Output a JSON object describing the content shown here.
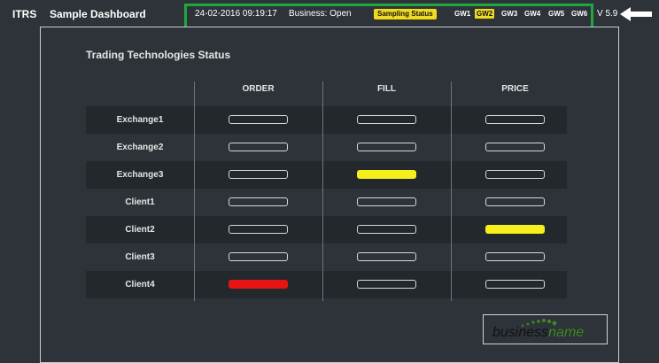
{
  "header": {
    "brand": "ITRS",
    "title": "Sample Dashboard",
    "datetime": "24-02-2016 09:19:17",
    "business_status": "Business: Open",
    "sampling_status": "Sampling Status",
    "gateways": [
      {
        "label": "GW1",
        "active": false
      },
      {
        "label": "GW2",
        "active": true
      },
      {
        "label": "GW3",
        "active": false
      },
      {
        "label": "GW4",
        "active": false
      },
      {
        "label": "GW5",
        "active": false
      },
      {
        "label": "GW6",
        "active": false
      }
    ],
    "version": "V 5.9"
  },
  "panel": {
    "title": "Trading Technologies Status",
    "columns": [
      "ORDER",
      "FILL",
      "PRICE"
    ],
    "rows": [
      {
        "label": "Exchange1",
        "states": [
          "ok",
          "ok",
          "ok"
        ]
      },
      {
        "label": "Exchange2",
        "states": [
          "ok",
          "ok",
          "ok"
        ]
      },
      {
        "label": "Exchange3",
        "states": [
          "ok",
          "warning",
          "ok"
        ]
      },
      {
        "label": "Client1",
        "states": [
          "ok",
          "ok",
          "ok"
        ]
      },
      {
        "label": "Client2",
        "states": [
          "ok",
          "ok",
          "warning"
        ]
      },
      {
        "label": "Client3",
        "states": [
          "ok",
          "ok",
          "ok"
        ]
      },
      {
        "label": "Client4",
        "states": [
          "critical",
          "ok",
          "ok"
        ]
      }
    ]
  },
  "logo": {
    "part1": "business",
    "part2": "name"
  },
  "colors": {
    "accent_green": "#1fa83f",
    "warning": "#f5ef1c",
    "critical": "#e81414",
    "highlight": "#f0dc1e"
  }
}
